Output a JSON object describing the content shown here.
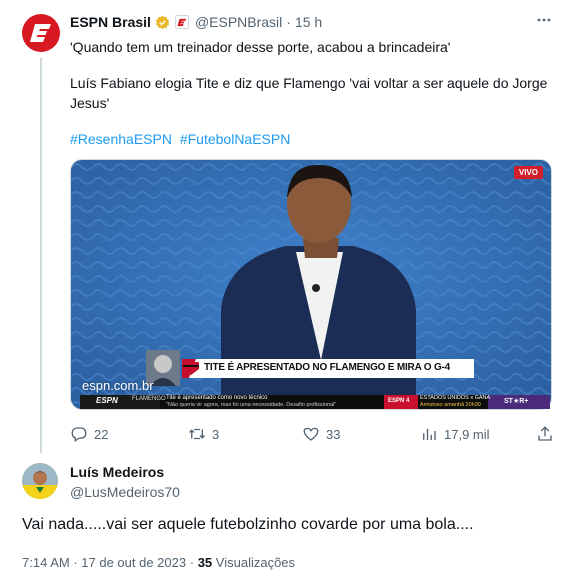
{
  "tweet": {
    "author_name": "ESPN Brasil",
    "handle": "@ESPNBrasil",
    "separator": "·",
    "time": "15 h",
    "line1": "'Quando tem um treinador desse porte, acabou a brincadeira'",
    "line2a": "Luís Fabiano elogia Tite e diz que Flamengo 'vai voltar a ser aquele do Jorge",
    "line2b": "Jesus'",
    "hashtags": [
      "#ResenhaESPN",
      "#FutebolNaESPN"
    ],
    "media": {
      "live_label": "VIVO",
      "headline": "TITE É APRESENTADO NO FLAMENGO E MIRA O G-4",
      "site": "espn.com.br",
      "network": "ESPN",
      "channel": "FLAMENGO",
      "ticker_title": "Tite é apresentado como novo técnico",
      "ticker_quote": "\"Não queria vir agora, mas foi uma necessidade. Desafio profissional\"",
      "next_label": "ESPN 4",
      "next_match": "ESTADOS UNIDOS x GANA",
      "next_detail": "Amistoso amanhã 20h30",
      "star_label": "ST★R+"
    },
    "actions": {
      "replies": "22",
      "retweets": "3",
      "likes": "33",
      "views": "17,9 mil"
    }
  },
  "reply": {
    "author_name": "Luís Medeiros",
    "handle": "@LusMedeiros70",
    "text": "Vai nada.....vai ser aquele futebolzinho covarde por uma bola....",
    "time": "7:14 AM",
    "date": "17 de out de 2023",
    "views_count": "35",
    "views_label": "Visualizações"
  },
  "colors": {
    "accent": "#1d9bf0",
    "espn_red": "#d71921",
    "secondary_text": "#536471"
  }
}
